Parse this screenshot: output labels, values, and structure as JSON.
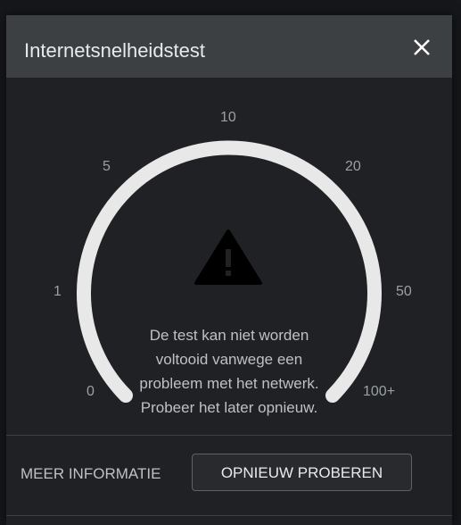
{
  "dialog": {
    "title": "Internetsnelheidstest",
    "close_icon": "close-icon"
  },
  "gauge": {
    "ticks": [
      "0",
      "1",
      "5",
      "10",
      "20",
      "50",
      "100+"
    ],
    "warning_icon": "warning-icon",
    "message": "De test kan niet worden voltooid vanwege een probleem met het netwerk. Probeer het later opnieuw."
  },
  "actions": {
    "more_info_label": "MEER INFORMATIE",
    "retry_label": "OPNIEUW PROBEREN"
  },
  "colors": {
    "header_bg": "#3c4043",
    "dialog_bg": "#202124",
    "gauge_arc": "#e8e8e8",
    "text_muted": "#9aa0a6"
  }
}
